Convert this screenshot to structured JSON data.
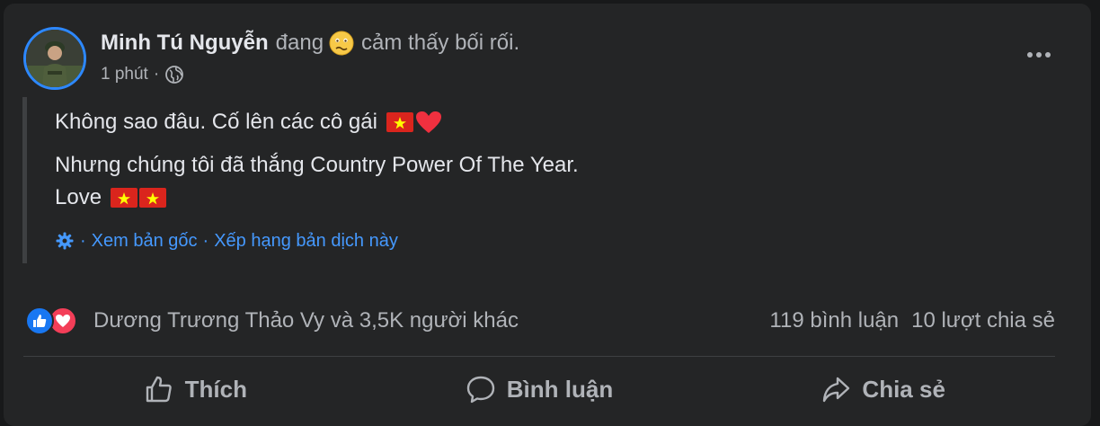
{
  "post": {
    "author": "Minh Tú Nguyễn",
    "activity_verb": "đang",
    "feeling_emoji": "confused-face-icon",
    "activity_text": "cảm thấy bối rối.",
    "timestamp": "1 phút",
    "separator": "·",
    "privacy_icon": "globe-icon",
    "lines": [
      "Không sao đâu. Cố lên các cô gái",
      "Nhưng chúng tôi đã thắng Country Power Of The Year.",
      "Love"
    ],
    "translation": {
      "separator": "·",
      "view_original": "Xem bản gốc",
      "rate_translation": "Xếp hạng bản dịch này"
    }
  },
  "engagement": {
    "reactions_text": "Dương Trương Thảo Vy và 3,5K người khác",
    "comments": "119 bình luận",
    "shares": "10 lượt chia sẻ"
  },
  "actions": {
    "like": "Thích",
    "comment": "Bình luận",
    "share": "Chia sẻ"
  },
  "colors": {
    "card_bg": "#242526",
    "text_primary": "#e4e6eb",
    "text_secondary": "#b0b3b8",
    "link_blue": "#4599ff",
    "like_blue": "#1877f2",
    "love_red": "#f33e58"
  }
}
